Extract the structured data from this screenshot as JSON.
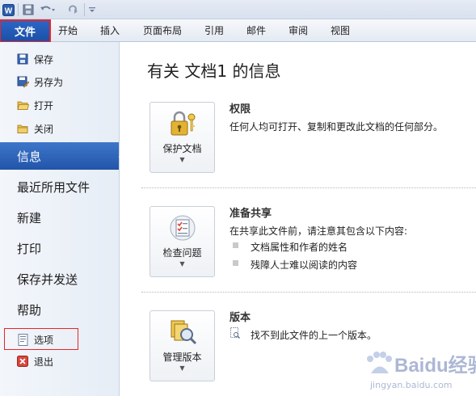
{
  "quick_access": {
    "icons": [
      "word-logo-icon",
      "save-icon",
      "undo-icon",
      "redo-icon",
      "customize-icon"
    ]
  },
  "ribbon": {
    "tabs": [
      {
        "label": "文件"
      },
      {
        "label": "开始"
      },
      {
        "label": "插入"
      },
      {
        "label": "页面布局"
      },
      {
        "label": "引用"
      },
      {
        "label": "邮件"
      },
      {
        "label": "审阅"
      },
      {
        "label": "视图"
      }
    ]
  },
  "sidebar": {
    "commands": [
      {
        "label": "保存",
        "icon": "save-icon"
      },
      {
        "label": "另存为",
        "icon": "save-as-icon"
      },
      {
        "label": "打开",
        "icon": "open-folder-icon"
      },
      {
        "label": "关闭",
        "icon": "close-folder-icon"
      }
    ],
    "nav": [
      {
        "label": "信息"
      },
      {
        "label": "最近所用文件"
      },
      {
        "label": "新建"
      },
      {
        "label": "打印"
      },
      {
        "label": "保存并发送"
      },
      {
        "label": "帮助"
      }
    ],
    "bottom": [
      {
        "label": "选项",
        "icon": "options-icon"
      },
      {
        "label": "退出",
        "icon": "exit-icon"
      }
    ],
    "selected": "信息"
  },
  "main": {
    "title": "有关 文档1 的信息",
    "sections": [
      {
        "button": "保护文档",
        "icon": "lock-keys-icon",
        "title": "权限",
        "desc": "任何人均可打开、复制和更改此文档的任何部分。"
      },
      {
        "button": "检查问题",
        "icon": "checklist-icon",
        "title": "准备共享",
        "desc": "在共享此文件前，请注意其包含以下内容:",
        "items": [
          "文档属性和作者的姓名",
          "残障人士难以阅读的内容"
        ]
      },
      {
        "button": "管理版本",
        "icon": "versions-icon",
        "title": "版本",
        "desc": "找不到此文件的上一个版本。"
      }
    ]
  },
  "watermark": {
    "text": "Baidu经验",
    "subtext": "jingyan.baidu.com"
  },
  "colors": {
    "file_tab": "#2b5fb8",
    "selected_nav": "#2f66bb",
    "highlight_box": "#e5262a"
  }
}
